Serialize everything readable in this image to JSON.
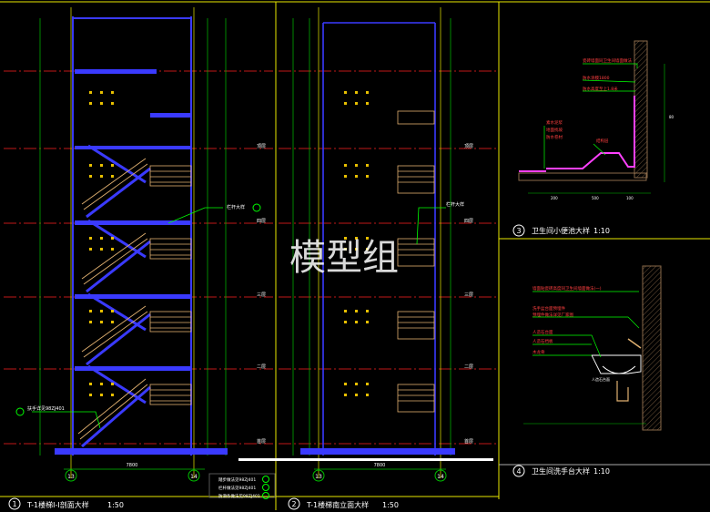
{
  "watermark": "模型组",
  "colors": {
    "background": "#000000",
    "frame": "#e8e800",
    "grid": "#ff2020",
    "stair": "#3a3aff",
    "rail": "#e0b070",
    "dim": "#00c000",
    "leader": "#00ff00",
    "text": "#ffffff"
  },
  "left_panel": {
    "circle_label": "1",
    "title": "T-1楼梯I-I剖面大样",
    "scale": "1:50",
    "axis_left": "13",
    "axis_right": "14",
    "bottom_dim": "7800",
    "callouts": [
      "扶手详见98ZJ401",
      "栏杆大样"
    ],
    "floor_labels": [
      "顶层",
      "四层",
      "三层",
      "二层",
      "首层"
    ]
  },
  "middle_panel": {
    "circle_label": "2",
    "title": "T-1楼梯南立面大样",
    "scale": "1:50",
    "axis_left": "13",
    "axis_right": "14",
    "bottom_dim": "7800",
    "callout": "栏杆大样",
    "floor_labels": [
      "顶层",
      "四层",
      "三层",
      "二层",
      "首层"
    ]
  },
  "notes": [
    {
      "text": "踏步做法见98ZJ401",
      "mark": "7"
    },
    {
      "text": "栏杆做法见98ZJ401",
      "mark": "8"
    },
    {
      "text": "防滑条做法见98ZJ401",
      "mark": "9"
    }
  ],
  "detail_3": {
    "circle_label": "3",
    "title": "卫生间小便池大样",
    "scale": "1:10",
    "labels": [
      "瓷砖墙面同卫生间墙面做法",
      "防水涂膜1800",
      "防水高度至上1.8米",
      "素水泥浆",
      "地面找坡",
      "防水卷材",
      "结构层"
    ],
    "dims": [
      "200",
      "500",
      "100",
      "80"
    ]
  },
  "detail_4": {
    "circle_label": "4",
    "title": "卫生间洗手台大样",
    "scale": "1:10",
    "labels": [
      "墙面贴瓷砖高度同卫生间墙面做法(一)",
      "洗手盆台面预埋件",
      "预埋件做法详见厂家图",
      "人造石台面",
      "人造石挡板",
      "木龙骨",
      "人造石台面"
    ]
  }
}
